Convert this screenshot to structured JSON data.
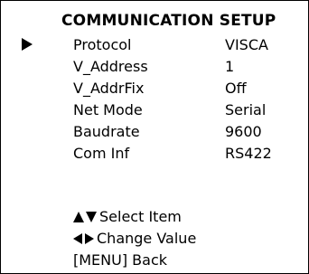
{
  "menu": {
    "title": "COMMUNICATION SETUP",
    "selected_index": 0,
    "items": [
      {
        "label": "Protocol",
        "value": "VISCA"
      },
      {
        "label": "V_Address",
        "value": "1"
      },
      {
        "label": "V_AddrFix",
        "value": "Off"
      },
      {
        "label": "Net Mode",
        "value": "Serial"
      },
      {
        "label": "Baudrate",
        "value": "9600"
      },
      {
        "label": "Com Inf",
        "value": "RS422"
      }
    ]
  },
  "help": {
    "select_item": "Select Item",
    "change_value": "Change Value",
    "back": "[MENU] Back"
  },
  "icons": {
    "cursor": "selection-arrow-right-icon",
    "up": "triangle-up-icon",
    "down": "triangle-down-icon",
    "left": "triangle-left-icon",
    "right": "triangle-right-icon"
  },
  "colors": {
    "background": "#ffffff",
    "text": "#000000",
    "border": "#000000"
  }
}
